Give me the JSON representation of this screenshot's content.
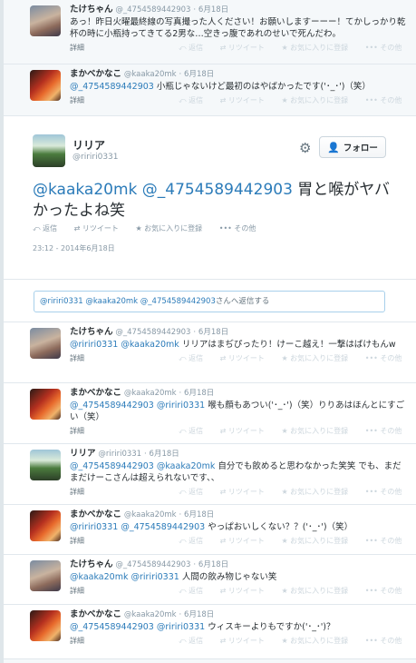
{
  "top_tweets": [
    {
      "name": "たけちゃん",
      "handle": "@_4754589442903",
      "date": "6月18日",
      "text": "あっ！昨日火曜最終線の写真撮った人ください！お願いしますーーー！てかしっかり乾杯の時に小瓶持ってきてる2男な…空きっ腹であれのせいで死んだわ。",
      "avatar": "take"
    },
    {
      "name": "まかべかなこ",
      "handle": "@kaaka20mk",
      "date": "6月18日",
      "mentions": "@_4754589442903",
      "text": " 小瓶じゃないけど最初のはやばかったです('･_･')（笑）",
      "avatar": "maka"
    }
  ],
  "labels": {
    "details": "詳細",
    "reply": "返信",
    "retweet": "リツイート",
    "favorite": "お気に入りに登録",
    "more": "その他",
    "follow": "フォロー"
  },
  "focus": {
    "name": "リリア",
    "handle": "@ririri0331",
    "mentions": "@kaaka20mk @_4754589442903",
    "text": " 胃と喉がヤバかったよね笑",
    "timestamp": "23:12 - 2014年6月18日"
  },
  "reply_box": {
    "prefix": "@ririri0331 @kaaka20mk @_4754589442903",
    "suffix": "さんへ返信する"
  },
  "replies": [
    {
      "name": "たけちゃん",
      "handle": "@_4754589442903",
      "date": "6月18日",
      "mentions": "@ririri0331 @kaaka20mk",
      "text": " リリアはまぢぴったり！けーこ越え！一撃はばけもんw",
      "avatar": "take"
    },
    {
      "name": "まかべかなこ",
      "handle": "@kaaka20mk",
      "date": "6月18日",
      "mentions": "@_4754589442903 @ririri0331",
      "text": " 喉も顔もあつい('･_･')（笑）りりあはほんとにすごい（笑）",
      "avatar": "maka"
    },
    {
      "name": "リリア",
      "handle": "@ririri0331",
      "date": "6月18日",
      "mentions": "@_4754589442903 @kaaka20mk",
      "text": " 自分でも飲めると思わなかった笑笑 でも、まだまだけーこさんは超えられないです、、",
      "avatar": "riri"
    },
    {
      "name": "まかべかなこ",
      "handle": "@kaaka20mk",
      "date": "6月18日",
      "mentions": "@ririri0331 @_4754589442903",
      "text": " やっぱおいしくない？？('･_･')（笑）",
      "avatar": "maka"
    },
    {
      "name": "たけちゃん",
      "handle": "@_4754589442903",
      "date": "6月18日",
      "mentions": "@kaaka20mk @ririri0331",
      "text": " 人間の飲み物じゃない笑",
      "avatar": "take"
    },
    {
      "name": "まかべかなこ",
      "handle": "@kaaka20mk",
      "date": "6月18日",
      "mentions": "@_4754589442903 @ririri0331",
      "text": " ウィスキーよりもですか('･_･')？",
      "avatar": "maka"
    }
  ]
}
